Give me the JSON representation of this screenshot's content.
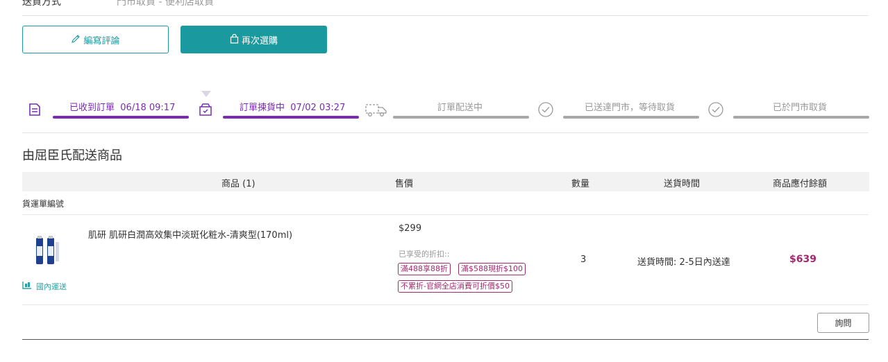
{
  "header": {
    "partial_label": "送貨方式",
    "partial_value": "門市取貨 - 便利店取貨"
  },
  "actions": {
    "review_label": "編寫評論",
    "rebuy_label": "再次選購"
  },
  "progress": {
    "steps": [
      {
        "label": "已收到訂單",
        "time": "06/18 09:17",
        "status": "done"
      },
      {
        "label": "訂單揀貨中",
        "time": "07/02 03:27",
        "status": "done"
      },
      {
        "label": "訂單配送中",
        "time": "",
        "status": "pending"
      },
      {
        "label": "已送達門市，等待取貨",
        "time": "",
        "status": "pending"
      },
      {
        "label": "已於門市取貨",
        "time": "",
        "status": "pending"
      }
    ],
    "done_color": "#7a2bb3",
    "pending_color": "#a8a8a8"
  },
  "section": {
    "title": "由屈臣氏配送商品"
  },
  "table": {
    "headers": {
      "product": "商品 (1)",
      "price": "售價",
      "qty": "數量",
      "delivery": "送貨時間",
      "amount": "商品應付餘額"
    },
    "tracking_label": "貨運單編號"
  },
  "item": {
    "name": "肌研 肌研白潤高效集中淡斑化粧水-清爽型(170ml)",
    "price": "$299",
    "discount_label": "已享受的折扣::",
    "tags": [
      "滿488享88折",
      "滿$588現折$100",
      "不累折-官網全店消費可折價$50"
    ],
    "quantity": "3",
    "delivery_time": "送貨時間: 2-5日內送達",
    "amount": "$639",
    "shipping_type": "國內運送"
  },
  "buttons": {
    "ask": "詢問"
  },
  "colors": {
    "teal": "#1a9a9f",
    "purple": "#7a2bb3",
    "magenta": "#a3296f"
  }
}
